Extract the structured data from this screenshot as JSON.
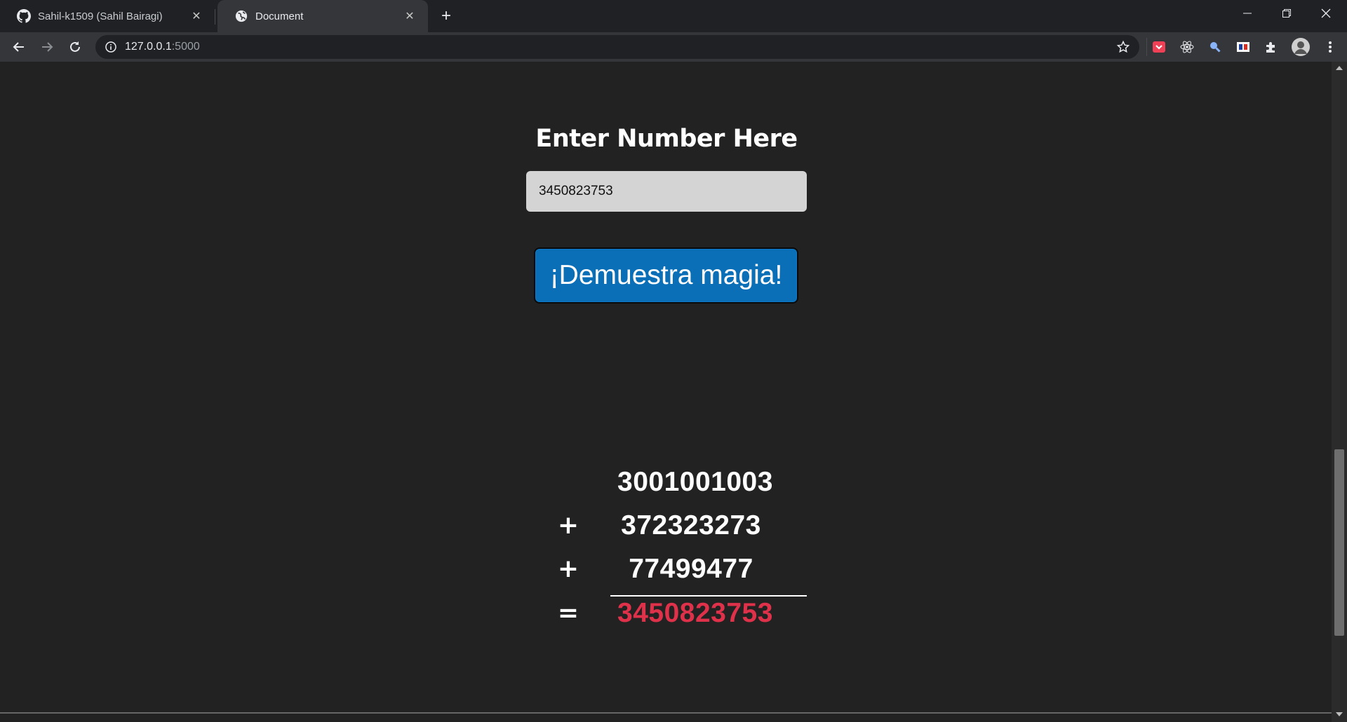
{
  "browser": {
    "tabs": [
      {
        "title": "Sahil-k1509 (Sahil Bairagi)",
        "icon": "github-icon"
      },
      {
        "title": "Document",
        "icon": "globe-icon"
      }
    ],
    "address": {
      "host": "127.0.0.1",
      "port": ":5000"
    }
  },
  "page": {
    "heading": "Enter Number Here",
    "input_value": "3450823753",
    "button_label": "¡Demuestra magia!",
    "sum": {
      "rows": [
        {
          "op": "",
          "value": "3001001003"
        },
        {
          "op": "+",
          "value": "372323273"
        },
        {
          "op": "+",
          "value": "77499477"
        }
      ],
      "result_op": "=",
      "result": "3450823753",
      "result_color": "#e0314a"
    }
  }
}
